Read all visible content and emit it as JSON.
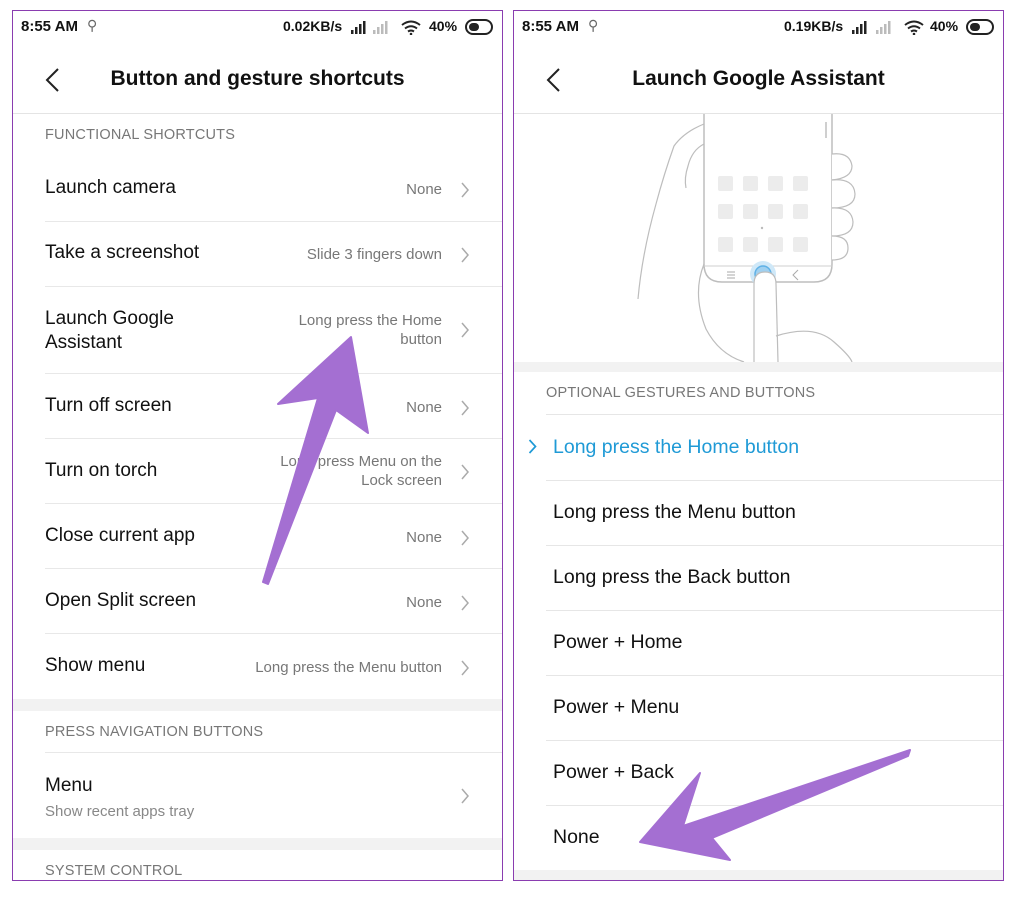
{
  "left": {
    "status": {
      "time": "8:55 AM",
      "speed": "0.02KB/s",
      "battery": "40%"
    },
    "title": "Button and gesture shortcuts",
    "sections": [
      {
        "header": "FUNCTIONAL SHORTCUTS",
        "items": [
          {
            "label": "Launch camera",
            "value": "None"
          },
          {
            "label": "Take a screenshot",
            "value": "Slide 3 fingers down"
          },
          {
            "label_line1": "Launch Google",
            "label_line2": "Assistant",
            "value_line1": "Long press the Home",
            "value_line2": "button"
          },
          {
            "label": "Turn off screen",
            "value": "None"
          },
          {
            "label": "Turn on torch",
            "value_line1": "Long press Menu on the",
            "value_line2": "Lock screen"
          },
          {
            "label": "Close current app",
            "value": "None"
          },
          {
            "label": "Open Split screen",
            "value": "None"
          },
          {
            "label": "Show menu",
            "value": "Long press the Menu button"
          }
        ]
      },
      {
        "header": "PRESS NAVIGATION BUTTONS",
        "items": [
          {
            "label": "Menu",
            "sublabel": "Show recent apps tray"
          }
        ]
      },
      {
        "header": "SYSTEM CONTROL",
        "items": []
      }
    ]
  },
  "right": {
    "status": {
      "time": "8:55 AM",
      "speed": "0.19KB/s",
      "battery": "40%"
    },
    "title": "Launch Google Assistant",
    "section_header": "OPTIONAL GESTURES AND BUTTONS",
    "options": [
      {
        "label": "Long press the Home button",
        "selected": true
      },
      {
        "label": "Long press the Menu button",
        "selected": false
      },
      {
        "label": "Long press the Back button",
        "selected": false
      },
      {
        "label": "Power + Home",
        "selected": false
      },
      {
        "label": "Power + Menu",
        "selected": false
      },
      {
        "label": "Power + Back",
        "selected": false
      },
      {
        "label": "None",
        "selected": false
      }
    ]
  },
  "icons": {
    "back": "back-arrow-icon",
    "chevron": "chevron-right-icon",
    "wifi": "wifi-icon",
    "signal": "signal-bars-icon",
    "battery": "battery-icon",
    "hotspot": "data-saver-icon"
  },
  "colors": {
    "accent_selected": "#1f9ad6",
    "annotation_arrow": "#a46fd2",
    "frame_border": "#8a3db0"
  }
}
